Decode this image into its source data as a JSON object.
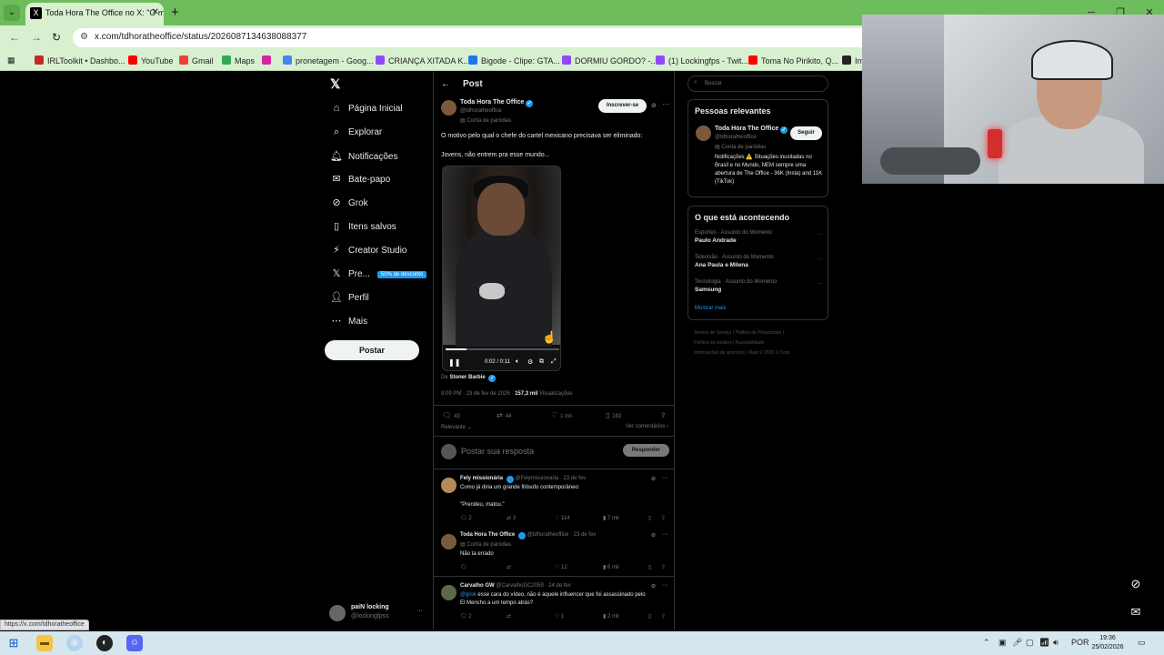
{
  "browser": {
    "tab_title": "Toda Hora The Office no X: \"O m",
    "url": "x.com/tdhoratheoffice/status/2026087134638088377",
    "bookmarks": [
      "IRLToolkit • Dashbo...",
      "YouTube",
      "Gmail",
      "Maps",
      "",
      "pronetagem - Goog...",
      "CRIANÇA XITADA K...",
      "Bigode - Clipe: GTA...",
      "DORMIU GORDO? -...",
      "(1) Lockingfps - Twit...",
      "Toma No Pirikito, Q...",
      "Im"
    ],
    "status_url": "https://x.com/tdhoratheoffice"
  },
  "nav": {
    "items": [
      {
        "label": "Página Inicial",
        "icon": "home-icon"
      },
      {
        "label": "Explorar",
        "icon": "search-icon"
      },
      {
        "label": "Notificações",
        "icon": "bell-icon"
      },
      {
        "label": "Bate-papo",
        "icon": "mail-icon"
      },
      {
        "label": "Grok",
        "icon": "grok-icon"
      },
      {
        "label": "Itens salvos",
        "icon": "bookmark-icon"
      },
      {
        "label": "Creator Studio",
        "icon": "creator-icon"
      },
      {
        "label": "Pre...",
        "icon": "x-icon"
      },
      {
        "label": "Perfil",
        "icon": "person-icon"
      },
      {
        "label": "Mais",
        "icon": "more-icon"
      }
    ],
    "premium_badge": "50% de desconto",
    "post_button": "Postar",
    "account_name": "paiN locking",
    "account_handle": "@lockingfpss"
  },
  "post": {
    "header": "Post",
    "author": "Toda Hora The Office",
    "handle": "@tdhoratheoffice",
    "label": "Conta de paródias",
    "subscribe": "Inscrever-se",
    "text1": "O motivo pelo qual o chefe do cartel mexicano precisava ser eliminado:",
    "text2": "Jovens, não entrem pra esse mundo...",
    "video_time": "0:02 / 0:11",
    "video_progress": 0.18,
    "credit_prefix": "De",
    "credit_name": "Stoner Barbie",
    "time": "9:09 PM · 23 de fev de 2026 · ",
    "views": "157,3 mil",
    "views_label": " Visualizações",
    "replies": "43",
    "reposts": "44",
    "likes": "1 mil",
    "bookmarks": "192",
    "sort": "Relevante",
    "see_quotes": "Ver comentários",
    "reply_placeholder": "Postar sua resposta",
    "reply_button": "Responder"
  },
  "comments": [
    {
      "name": "Fely missionária",
      "handle": "@Felymissionaria",
      "date": "· 23 de fev",
      "lines": [
        "Como já diria um grande filósofo contemporâneo:",
        "",
        "\"Prendeu, matou.\""
      ],
      "replies": "2",
      "reposts": "3",
      "likes": "114",
      "views": "7 mil"
    },
    {
      "name": "Toda Hora The Office",
      "handle": "@tdhoratheoffice",
      "date": "· 23 de fev",
      "label": "Conta de paródias",
      "lines": [
        "Não ta errado"
      ],
      "replies": "",
      "reposts": "",
      "likes": "12",
      "views": "6 mil"
    },
    {
      "name": "Carvalho GW",
      "handle": "@CarvalhoGC2059",
      "date": "· 24 de fev",
      "mention": "@grok",
      "lines": [
        " esse cara do vídeo, não é aquele influencer que foi assassinado pelo",
        "El Mencho a um tempo atrás?"
      ],
      "replies": "2",
      "reposts": "",
      "likes": "1",
      "views": "2 mil"
    }
  ],
  "right": {
    "search_placeholder": "Buscar",
    "relevant_title": "Pessoas relevantes",
    "rp_name": "Toda Hora The Office",
    "rp_handle": "@tdhoratheoffice",
    "rp_label": "Conta de paródias",
    "follow": "Seguir",
    "rp_bio": "Notificações ⚠️ Situações inusitadas no Brasil e no Mundo, NEM sempre uma abertura de The Office - 36K (Insta) and 11K (TikTok)",
    "trending_title": "O que está acontecendo",
    "trends": [
      {
        "category": "Esportes · Assunto do Momento",
        "title": "Paulo Andrade"
      },
      {
        "category": "Televisão · Assunto do Momento",
        "title": "Ana Paula e Milena"
      },
      {
        "category": "Tecnologia · Assunto do Momento",
        "title": "Samsung"
      }
    ],
    "show_more": "Mostrar mais",
    "footer": [
      "Termos de Serviço",
      "Política de Privacidade",
      "Política de cookies",
      "Acessibilidade",
      "Informações de anúncios",
      "Mais",
      "© 2026 X Corp."
    ]
  },
  "taskbar": {
    "lang": "POR",
    "time": "19:36",
    "date": "25/02/2026"
  },
  "colors": {
    "accent": "#1d9bf0",
    "tab_bar": "#6dbd5c",
    "page_bg": "#000000"
  }
}
